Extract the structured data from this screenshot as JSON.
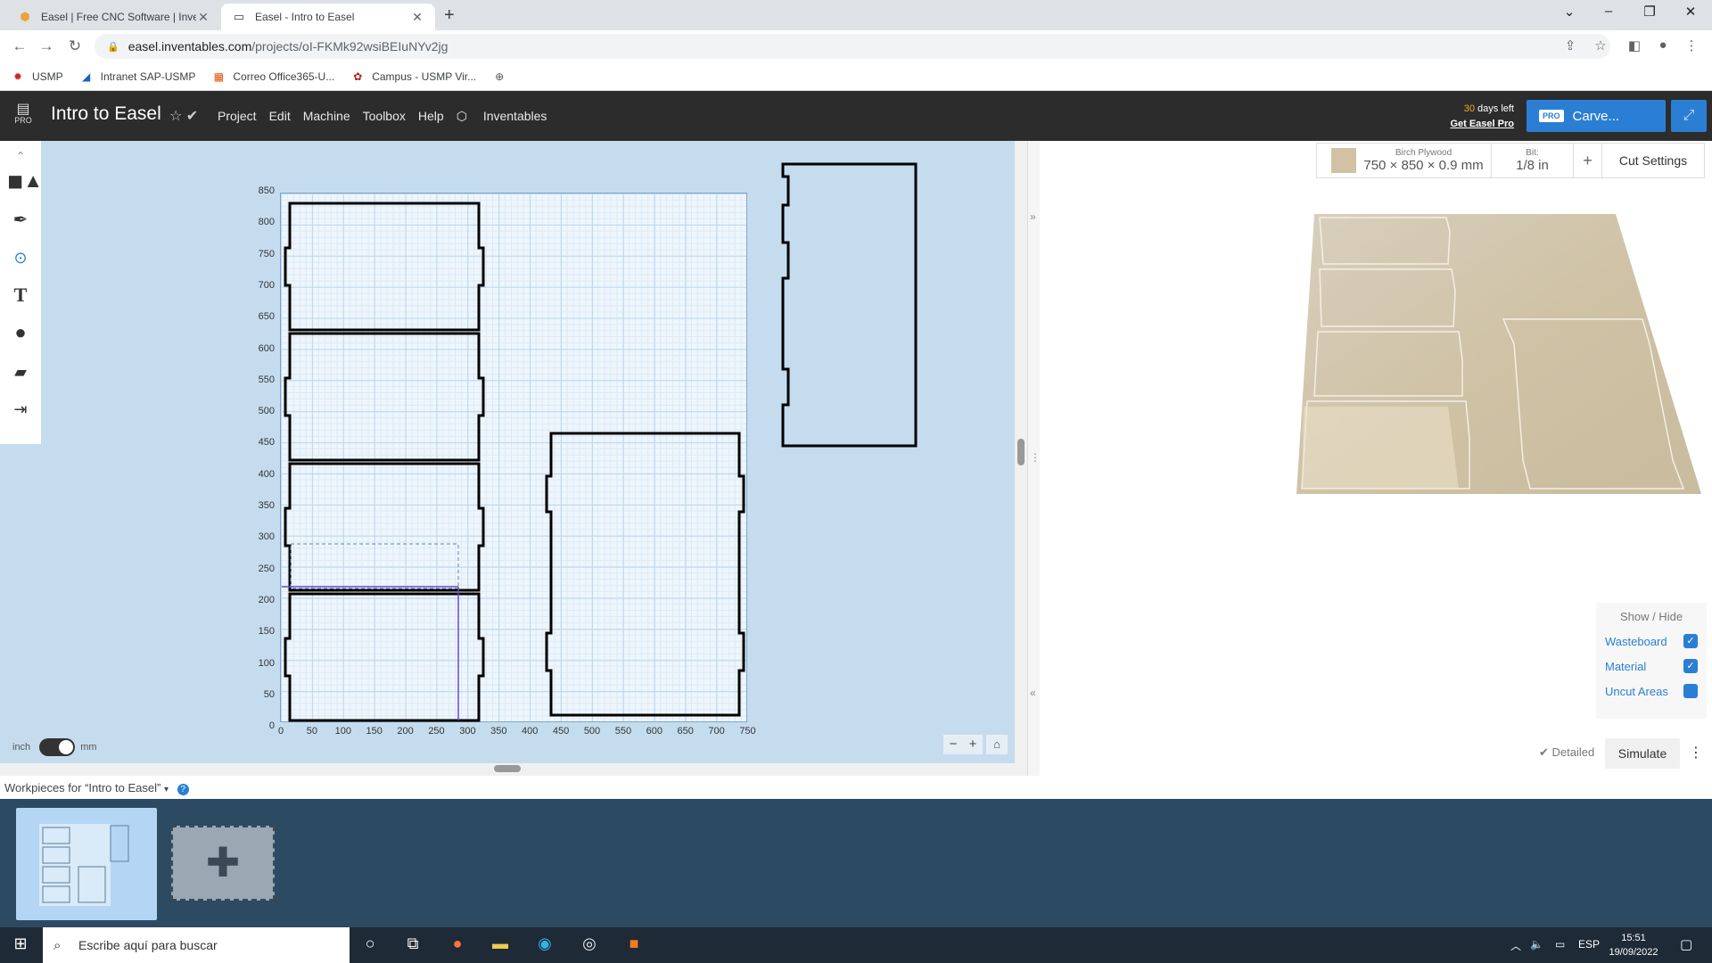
{
  "browser": {
    "tabs": [
      {
        "title": "Easel | Free CNC Software | Inven",
        "favicon": "easel-hex-icon"
      },
      {
        "title": "Easel - Intro to Easel",
        "favicon": "monitor-icon"
      }
    ],
    "url_domain": "easel.inventables.com",
    "url_path": "/projects/oI-FKMk92wsiBEIuNYv2jg",
    "bookmarks": [
      {
        "label": "USMP",
        "color": "#c62828"
      },
      {
        "label": "Intranet SAP-USMP",
        "color": "#1565c0"
      },
      {
        "label": "Correo Office365-U...",
        "color": "#e65100"
      },
      {
        "label": "Campus - USMP Vir...",
        "color": "#b71c1c"
      }
    ]
  },
  "app": {
    "logo_text": "PRO",
    "project_title": "Intro to Easel",
    "menu": [
      "Project",
      "Edit",
      "Machine",
      "Toolbox",
      "Help"
    ],
    "inventables": "Inventables",
    "trial_days": "30",
    "trial_suffix": " days left",
    "get_pro": "Get Easel Pro",
    "pro_badge": "PRO",
    "carve_label": "Carve...",
    "accent": "#2a7fd4"
  },
  "workarea": {
    "y_ticks": [
      "850",
      "800",
      "750",
      "700",
      "650",
      "600",
      "550",
      "500",
      "450",
      "400",
      "350",
      "300",
      "250",
      "200",
      "150",
      "100",
      "50",
      "0"
    ],
    "x_ticks": [
      "0",
      "50",
      "100",
      "150",
      "200",
      "250",
      "300",
      "350",
      "400",
      "450",
      "500",
      "550",
      "600",
      "650",
      "700",
      "750"
    ],
    "unit_left": "inch",
    "unit_right": "mm"
  },
  "material": {
    "name": "Birch Plywood",
    "dimensions": "750 × 850 × 0.9 mm",
    "bit_label": "Bit:",
    "bit_value": "1/8 in",
    "cut_settings": "Cut Settings"
  },
  "showhide": {
    "title": "Show / Hide",
    "items": [
      {
        "label": "Wasteboard",
        "checked": true
      },
      {
        "label": "Material",
        "checked": true
      },
      {
        "label": "Uncut Areas",
        "checked": false
      }
    ]
  },
  "preview_controls": {
    "detailed": "Detailed",
    "simulate": "Simulate"
  },
  "workpieces": {
    "header": "Workpieces for “Intro to Easel”"
  },
  "taskbar": {
    "search_placeholder": "Escribe aquí para buscar",
    "lang": "ESP",
    "time": "15:51",
    "date": "19/09/2022"
  }
}
